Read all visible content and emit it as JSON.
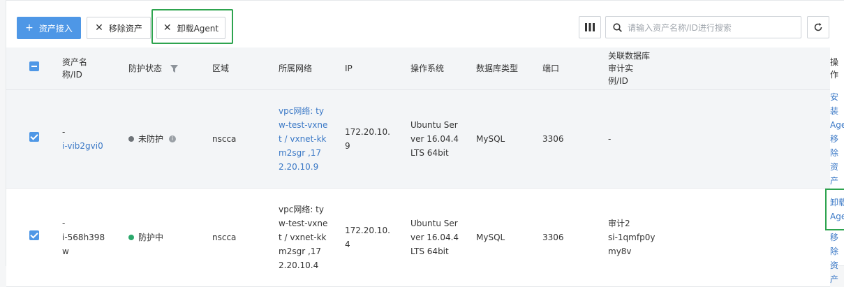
{
  "toolbar": {
    "add_label": "资产接入",
    "remove_label": "移除资产",
    "uninstall_label": "卸载Agent",
    "search_placeholder": "请输入资产名称/ID进行搜索"
  },
  "table": {
    "headers": {
      "name": "资产名\n称/ID",
      "status": "防护状态",
      "region": "区域",
      "network": "所属网络",
      "ip": "IP",
      "os": "操作系统",
      "dbtype": "数据库类型",
      "port": "端口",
      "audit": "关联数据库\n审计实\n例/ID",
      "ops": "操作"
    },
    "rows": [
      {
        "name": "-",
        "id": "i-vib2gvi0",
        "status": "未防护",
        "status_color": "#6e7378",
        "region": "nscca",
        "network": "vpc网络: ty\nw-test-vxne\nt / vxnet-kk\nm2sgr ,17\n2.20.10.9",
        "ip": "172.20.10.\n9",
        "os": "Ubuntu Ser\nver 16.04.4\nLTS 64bit",
        "dbtype": "MySQL",
        "port": "3306",
        "audit_name": "-",
        "audit_id": "",
        "op1": "安装Agent",
        "op2": "移除资产"
      },
      {
        "name": "-",
        "id": "i-568h398\nw",
        "status": "防护中",
        "status_color": "#2aa86b",
        "region": "nscca",
        "network": "vpc网络: ty\nw-test-vxne\nt / vxnet-kk\nm2sgr ,17\n2.20.10.4",
        "ip": "172.20.10.\n4",
        "os": "Ubuntu Ser\nver 16.04.4\nLTS 64bit",
        "dbtype": "MySQL",
        "port": "3306",
        "audit_name": "审计2",
        "audit_id": "si-1qmfp0y\nmy8v",
        "op1": "卸载Agent",
        "op2": "移除资产"
      }
    ]
  }
}
